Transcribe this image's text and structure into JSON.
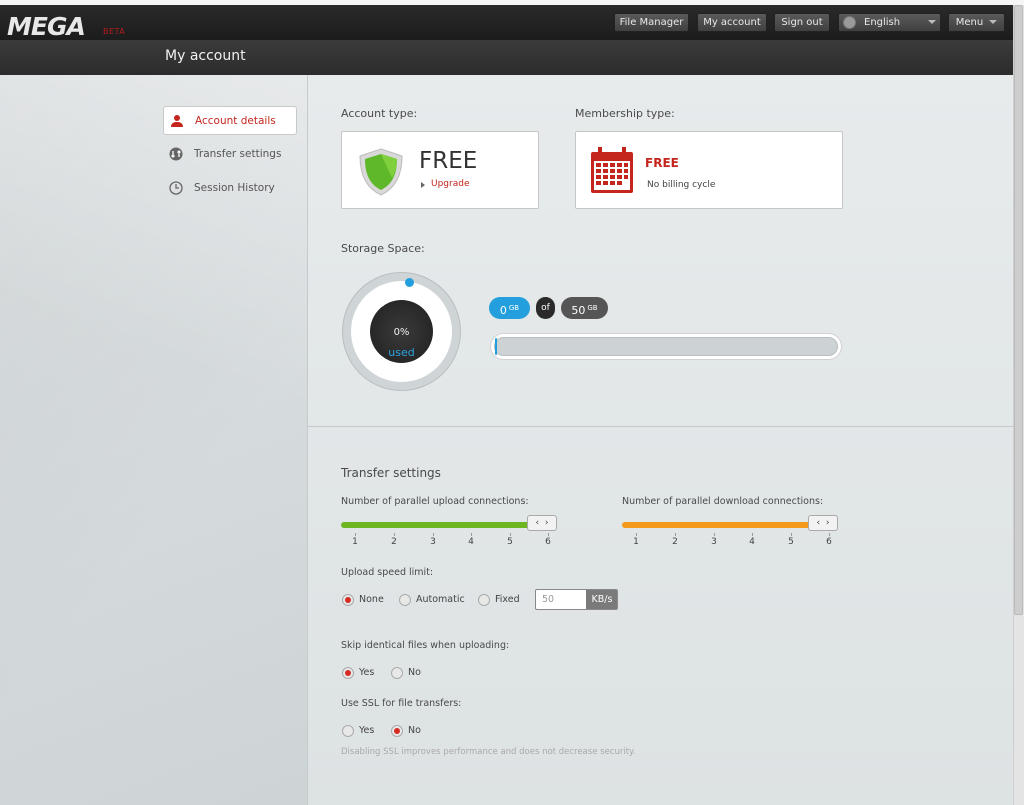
{
  "app": {
    "logo": "MEGA",
    "beta": "BETA"
  },
  "topnav": {
    "file_manager": "File Manager",
    "my_account": "My account",
    "sign_out": "Sign out",
    "language": "English",
    "menu": "Menu"
  },
  "header": {
    "title": "My account"
  },
  "sidebar": {
    "items": [
      {
        "label": "Account details",
        "icon": "user-icon",
        "active": true
      },
      {
        "label": "Transfer settings",
        "icon": "transfer-icon",
        "active": false
      },
      {
        "label": "Session History",
        "icon": "clock-icon",
        "active": false
      }
    ]
  },
  "account": {
    "type_label": "Account type:",
    "type_value": "FREE",
    "upgrade": "Upgrade"
  },
  "membership": {
    "label": "Membership type:",
    "value": "FREE",
    "billing": "No billing cycle"
  },
  "storage": {
    "label": "Storage Space:",
    "percent": "0%",
    "used_label": "used",
    "used_value": "0",
    "used_unit": "GB",
    "of": "of",
    "total_value": "50",
    "total_unit": "GB",
    "used_fraction": 0.0
  },
  "transfer": {
    "title": "Transfer settings",
    "upload": {
      "label": "Number of parallel upload connections:",
      "ticks": [
        "1",
        "2",
        "3",
        "4",
        "5",
        "6"
      ],
      "value": 6
    },
    "download": {
      "label": "Number of parallel download connections:",
      "ticks": [
        "1",
        "2",
        "3",
        "4",
        "5",
        "6"
      ],
      "value": 6
    },
    "speed": {
      "label": "Upload speed limit:",
      "options": [
        "None",
        "Automatic",
        "Fixed"
      ],
      "selected": "None",
      "value": "50",
      "unit": "KB/s"
    },
    "skip": {
      "label": "Skip identical files when uploading:",
      "options": [
        "Yes",
        "No"
      ],
      "selected": "Yes"
    },
    "ssl": {
      "label": "Use SSL for file transfers:",
      "options": [
        "Yes",
        "No"
      ],
      "selected": "No",
      "note": "Disabling SSL improves performance and does not decrease security."
    }
  },
  "colors": {
    "accent_red": "#c4261d",
    "blue": "#239fde",
    "upload_green": "#6cb621",
    "download_orange": "#f39a1c"
  }
}
